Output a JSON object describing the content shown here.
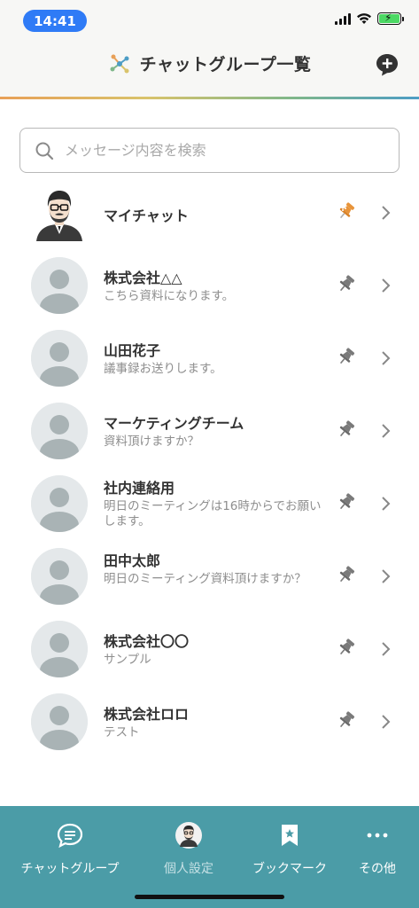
{
  "status_bar": {
    "time": "14:41"
  },
  "header": {
    "title": "チャットグループ一覧"
  },
  "search": {
    "placeholder": "メッセージ内容を検索"
  },
  "chats": [
    {
      "name": "マイチャット",
      "subtitle": "",
      "avatar": "man-with-glasses",
      "pinned": true
    },
    {
      "name": "株式会社△△",
      "subtitle": "こちら資料になります。",
      "avatar": "default",
      "pinned": false
    },
    {
      "name": "山田花子",
      "subtitle": "議事録お送りします。",
      "avatar": "default",
      "pinned": false
    },
    {
      "name": "マーケティングチーム",
      "subtitle": "資料頂けますか？",
      "avatar": "default",
      "pinned": false
    },
    {
      "name": "社内連絡用",
      "subtitle": "明日のミーティングは16時からでお願いします。",
      "avatar": "default",
      "pinned": false
    },
    {
      "name": "田中太郎",
      "subtitle": "明日のミーティング資料頂けますか？",
      "avatar": "default",
      "pinned": false
    },
    {
      "name": "株式会社〇〇",
      "subtitle": "サンプル",
      "avatar": "default",
      "pinned": false
    },
    {
      "name": "株式会社ロロ",
      "subtitle": "テスト",
      "avatar": "default",
      "pinned": false
    }
  ],
  "bottom_nav": [
    {
      "label": "チャットグループ",
      "icon": "chat-bubble-icon",
      "active": true
    },
    {
      "label": "個人設定",
      "icon": "profile-avatar-icon",
      "active": false
    },
    {
      "label": "ブックマーク",
      "icon": "bookmark-star-icon",
      "active": false
    },
    {
      "label": "その他",
      "icon": "more-dots-icon",
      "active": false
    }
  ],
  "colors": {
    "accent_nav": "#4b9ca7",
    "time_pill": "#2f7bf6",
    "pin_active": "#e8943a",
    "pin_inactive": "#7a7a7a"
  }
}
